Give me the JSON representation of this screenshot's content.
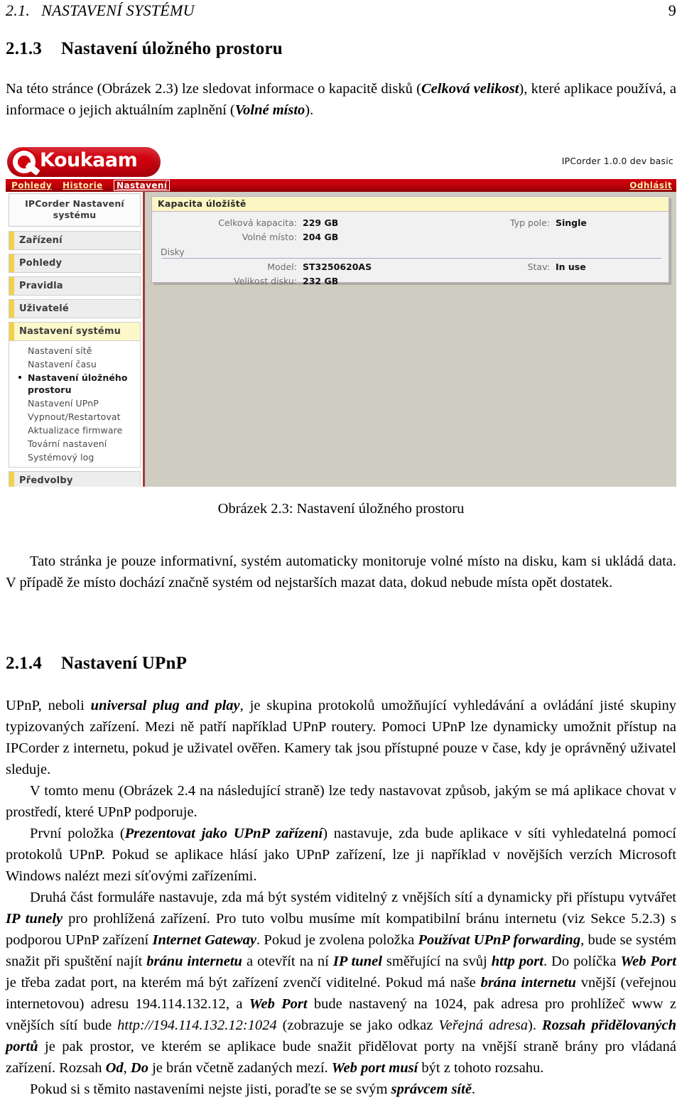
{
  "runhead": {
    "section_number": "2.1.",
    "section_title": "NASTAVENÍ SYSTÉMU",
    "page_number": "9"
  },
  "sections": {
    "s213": {
      "number": "2.1.3",
      "title": "Nastavení úložného prostoru"
    },
    "s214": {
      "number": "2.1.4",
      "title": "Nastavení UPnP"
    }
  },
  "paragraphs": {
    "intro_a": "Na této stránce (Obrázek 2.3) lze sledovat informace o kapacitě disků (",
    "intro_b": "Celková velikost",
    "intro_c": "), které aplikace používá, a informace o jejich aktuálním zaplnění (",
    "intro_d": "Volné místo",
    "intro_e": ").",
    "after_fig": "Tato stránka je pouze informativní, systém automaticky monitoruje volné místo na disku, kam si ukládá data. V případě že místo dochází značně systém od nejstarších mazat data, dokud nebude místa opět dostatek.",
    "upnp1_a": "UPnP, neboli ",
    "upnp1_b": "universal plug and play",
    "upnp1_c": ", je skupina protokolů umožňující vyhledávání a ovládání jisté skupiny typizovaných zařízení. Mezi ně patří například UPnP routery. Pomoci UPnP lze dynamicky umožnit přístup na IPCorder z internetu, pokud je uživatel ověřen. Kamery tak jsou přístupné pouze v čase, kdy je oprávněný uživatel sleduje.",
    "upnp2": "V tomto menu (Obrázek 2.4 na následující straně) lze tedy nastavovat způsob, jakým se má aplikace chovat v prostředí, které UPnP podporuje.",
    "upnp3_a": "První položka (",
    "upnp3_b": "Prezentovat jako UPnP zařízení",
    "upnp3_c": ") nastavuje, zda bude aplikace v síti vyhledatelná pomocí protokolů UPnP. Pokud se aplikace hlásí jako UPnP zařízení, lze ji například v novějších verzích Microsoft Windows nalézt mezi síťovými zařízeními.",
    "upnp4_a": "Druhá část formuláře nastavuje, zda má být systém viditelný z vnějších sítí a dynamicky při přístupu vytvářet ",
    "upnp4_b": "IP tunely",
    "upnp4_c": " pro prohlížená zařízení. Pro tuto volbu musíme mít kompatibilní bránu internetu (viz Sekce 5.2.3) s podporou UPnP zařízení ",
    "upnp4_d": "Internet Gateway",
    "upnp4_e": ". Pokud je zvolena položka ",
    "upnp4_f": "Používat UPnP forwarding",
    "upnp4_g": ", bude se systém snažit při spuštění najít ",
    "upnp4_h": "bránu internetu",
    "upnp4_i": " a otevřít na ní ",
    "upnp4_j": "IP tunel",
    "upnp4_k": " směřující na svůj ",
    "upnp4_l": "http port",
    "upnp4_m": ". Do políčka ",
    "upnp4_n": "Web Port",
    "upnp4_o": " je třeba zadat port, na kterém má být zařízení zvenčí viditelné. Pokud má naše ",
    "upnp4_p": "brána internetu",
    "upnp4_q": " vnější (veřejnou internetovou) adresu 194.114.132.12, a ",
    "upnp4_r": "Web Port",
    "upnp4_s": " bude nastavený na 1024, pak adresa pro prohlížeč www z vnějších sítí bude ",
    "upnp4_t": "http://194.114.132.12:1024",
    "upnp4_u": " (zobrazuje se jako odkaz ",
    "upnp4_v": "Veřejná adresa",
    "upnp4_w": "). ",
    "upnp4_x": "Rozsah přidělovaných portů",
    "upnp4_y": " je pak prostor, ve kterém se aplikace bude snažit přidělovat porty na vnější straně brány pro vládaná zařízení. Rozsah ",
    "upnp4_z": "Od",
    "upnp4_aa": ", ",
    "upnp4_ab": "Do",
    "upnp4_ac": " je brán včetně zadaných mezí. ",
    "upnp4_ad": "Web port musí",
    "upnp4_ae": " být z tohoto rozsahu.",
    "upnp5_a": "Pokud si s těmito nastaveními nejste jisti, poraďte se se svým ",
    "upnp5_b": "správcem sítě",
    "upnp5_c": "."
  },
  "figure": {
    "caption_label": "Obrázek 2.3:",
    "caption_text": "Nastavení úložného prostoru"
  },
  "app": {
    "brand_name": "Koukaam",
    "version": "IPCorder 1.0.0 dev basic",
    "nav": [
      {
        "label": "Pohledy",
        "active": false
      },
      {
        "label": "Historie",
        "active": false
      },
      {
        "label": "Nastavení",
        "active": true
      }
    ],
    "logout_label": "Odhlásit",
    "sidebar": {
      "title": "IPCorder Nastavení systému",
      "items": [
        {
          "label": "Zařízení",
          "selected": false
        },
        {
          "label": "Pohledy",
          "selected": false
        },
        {
          "label": "Pravidla",
          "selected": false
        },
        {
          "label": "Uživatelé",
          "selected": false
        },
        {
          "label": "Nastavení systému",
          "selected": true
        }
      ],
      "submenu": [
        {
          "label": "Nastavení sítě",
          "current": false
        },
        {
          "label": "Nastavení času",
          "current": false
        },
        {
          "label": "Nastavení úložného prostoru",
          "current": true
        },
        {
          "label": "Nastavení UPnP",
          "current": false
        },
        {
          "label": "Vypnout/Restartovat",
          "current": false
        },
        {
          "label": "Aktualizace firmware",
          "current": false
        },
        {
          "label": "Tovární nastavení",
          "current": false
        },
        {
          "label": "Systémový log",
          "current": false
        }
      ],
      "footer_item": {
        "label": "Předvolby"
      }
    },
    "panel": {
      "title": "Kapacita úložiště",
      "rows": [
        {
          "k1": "Celková kapacita:",
          "v1": "229 GB",
          "k2": "Typ pole:",
          "v2": "Single"
        },
        {
          "k1": "Volné místo:",
          "v1": "204 GB",
          "k2": "",
          "v2": ""
        }
      ],
      "group_label": "Disky",
      "disk_rows": [
        {
          "k1": "Model:",
          "v1": "ST3250620AS",
          "k2": "Stav:",
          "v2": "In use"
        },
        {
          "k1": "Velikost disku:",
          "v1": "232 GB",
          "k2": "",
          "v2": ""
        }
      ]
    }
  },
  "colors": {
    "brand_red": "#d1000e",
    "panel_header_yellow": "#fbf6c2",
    "sidebar_accent": "#f2d14a",
    "content_bg": "#cfccc2"
  }
}
